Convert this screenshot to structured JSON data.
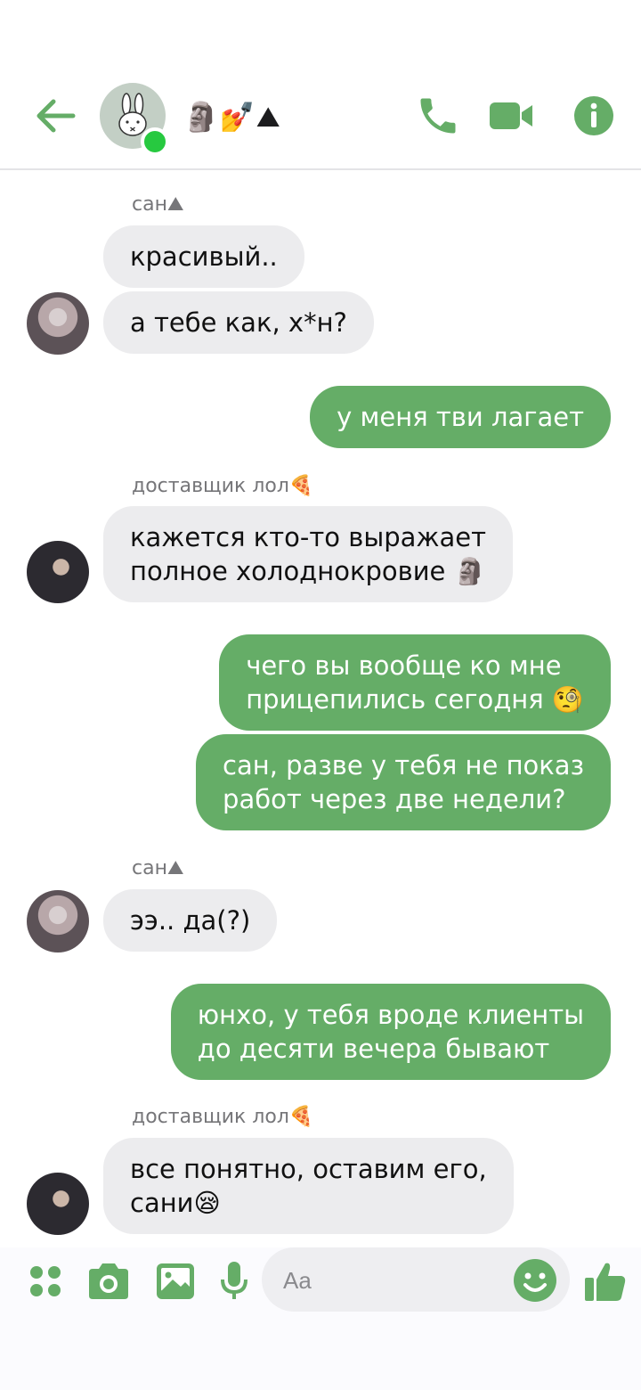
{
  "header": {
    "title": "🗿💅⛰",
    "accent_color": "#65ad67",
    "online_color": "#27c940"
  },
  "messages": [
    {
      "sender": "сан⛰",
      "text": "красивый..",
      "direction": "in"
    },
    {
      "text": "а тебе как, х*н?",
      "direction": "in"
    },
    {
      "text": "у меня тви лагает",
      "direction": "out"
    },
    {
      "sender": "доставщик лол🍕",
      "line1": "кажется кто-то выражает",
      "line2": "полное холоднокровие 🗿",
      "direction": "in"
    },
    {
      "line1": "чего вы вообще ко мне",
      "line2": "прицепились сегодня 🧐",
      "direction": "out"
    },
    {
      "line1": "сан, разве у тебя не показ",
      "line2": "работ через две недели?",
      "direction": "out"
    },
    {
      "sender": "сан⛰",
      "text": "ээ.. да(?)",
      "direction": "in"
    },
    {
      "line1": "юнхо, у тебя вроде клиенты",
      "line2": "до десяти вечера бывают",
      "direction": "out"
    },
    {
      "sender": "доставщик лол🍕",
      "line1": "все понятно, оставим его,",
      "line2": "сани😪",
      "direction": "in"
    }
  ],
  "composer": {
    "placeholder": "Aa"
  }
}
